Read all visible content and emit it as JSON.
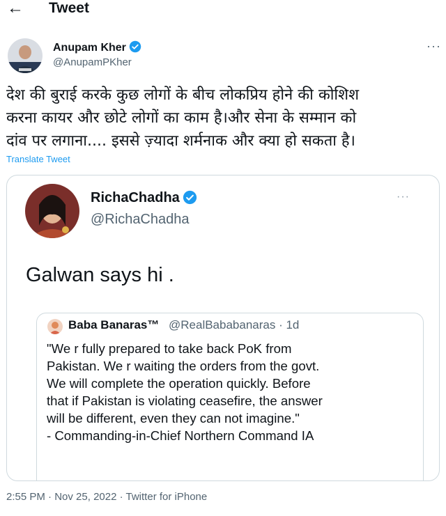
{
  "header": {
    "back_icon": "arrow-left-icon",
    "title": "Tweet"
  },
  "author": {
    "name": "Anupam Kher",
    "handle": "@AnupamPKher",
    "verified_icon": "verified-badge-icon",
    "verified_color": "#1d9bf0",
    "more_icon": "more-horizontal-icon"
  },
  "tweet": {
    "text": "देश की बुराई करके कुछ लोगों के बीच लोकप्रिय होने की कोशिश\nकरना कायर और छोटे लोगों का काम है।और सेना के सम्मान को\nदांव पर लगाना.... इससे ज़्यादा शर्मनाक और क्या हो सकता है।",
    "translate_label": "Translate Tweet"
  },
  "quoted_tweet": {
    "name": "RichaChadha",
    "handle": "@RichaChadha",
    "text": "Galwan says hi .",
    "inner_quote": {
      "name": "Baba Banaras™",
      "handle_time": "@RealBababanaras · 1d",
      "text": "\"We r fully prepared to take back PoK from\nPakistan. We r waiting the orders from the govt.\nWe will complete the operation quickly. Before\nthat if Pakistan is violating ceasefire, the answer\nwill be different, even they can not imagine.\"\n- Commanding-in-Chief Northern Command IA"
    }
  },
  "meta": {
    "time": "2:55 PM",
    "date": "Nov 25, 2022",
    "sep1": " · ",
    "sep2": " · ",
    "source": "Twitter for iPhone"
  },
  "colors": {
    "link": "#1d9bf0",
    "secondary_text": "#536471",
    "border": "#cfd9de"
  }
}
